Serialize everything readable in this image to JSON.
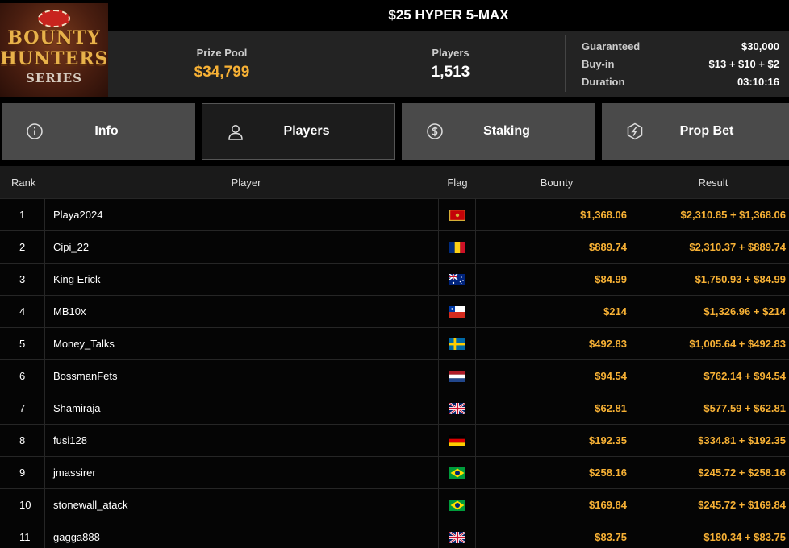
{
  "logo": {
    "line1": "BOUNTY",
    "line2": "HUNTERS",
    "line3": "SERIES"
  },
  "header": {
    "title": "$25 HYPER 5-MAX"
  },
  "stats": {
    "prize_pool_label": "Prize Pool",
    "prize_pool_value": "$34,799",
    "players_label": "Players",
    "players_value": "1,513",
    "details": [
      {
        "key": "Guaranteed",
        "value": "$30,000"
      },
      {
        "key": "Buy-in",
        "value": "$13 + $10 + $2"
      },
      {
        "key": "Duration",
        "value": "03:10:16"
      }
    ]
  },
  "tabs": [
    {
      "label": "Info",
      "icon": "info-icon"
    },
    {
      "label": "Players",
      "icon": "user-icon",
      "active": true
    },
    {
      "label": "Staking",
      "icon": "dollar-coin-icon"
    },
    {
      "label": "Prop Bet",
      "icon": "prop-bet-icon"
    }
  ],
  "table": {
    "headers": {
      "rank": "Rank",
      "player": "Player",
      "flag": "Flag",
      "bounty": "Bounty",
      "result": "Result"
    },
    "rows": [
      {
        "rank": "1",
        "player": "Playa2024",
        "flag": "montenegro",
        "bounty": "$1,368.06",
        "result": "$2,310.85 + $1,368.06"
      },
      {
        "rank": "2",
        "player": "Cipi_22",
        "flag": "romania",
        "bounty": "$889.74",
        "result": "$2,310.37 + $889.74"
      },
      {
        "rank": "3",
        "player": "King Erick",
        "flag": "australia",
        "bounty": "$84.99",
        "result": "$1,750.93 + $84.99"
      },
      {
        "rank": "4",
        "player": "MB10x",
        "flag": "chile",
        "bounty": "$214",
        "result": "$1,326.96 + $214"
      },
      {
        "rank": "5",
        "player": "Money_Talks",
        "flag": "sweden",
        "bounty": "$492.83",
        "result": "$1,005.64 + $492.83"
      },
      {
        "rank": "6",
        "player": "BossmanFets",
        "flag": "netherlands",
        "bounty": "$94.54",
        "result": "$762.14 + $94.54"
      },
      {
        "rank": "7",
        "player": "Shamiraja",
        "flag": "united-kingdom",
        "bounty": "$62.81",
        "result": "$577.59 + $62.81"
      },
      {
        "rank": "8",
        "player": "fusi128",
        "flag": "germany",
        "bounty": "$192.35",
        "result": "$334.81 + $192.35"
      },
      {
        "rank": "9",
        "player": "jmassirer",
        "flag": "brazil",
        "bounty": "$258.16",
        "result": "$245.72 + $258.16"
      },
      {
        "rank": "10",
        "player": "stonewall_atack",
        "flag": "brazil",
        "bounty": "$169.84",
        "result": "$245.72 + $169.84"
      },
      {
        "rank": "11",
        "player": "gagga888",
        "flag": "united-kingdom",
        "bounty": "$83.75",
        "result": "$180.34 + $83.75"
      }
    ]
  },
  "colors": {
    "accent": "#f7b135",
    "tab_bg": "#4a4a4a",
    "tab_active_bg": "#1c1c1c",
    "panel_bg": "#232323"
  }
}
